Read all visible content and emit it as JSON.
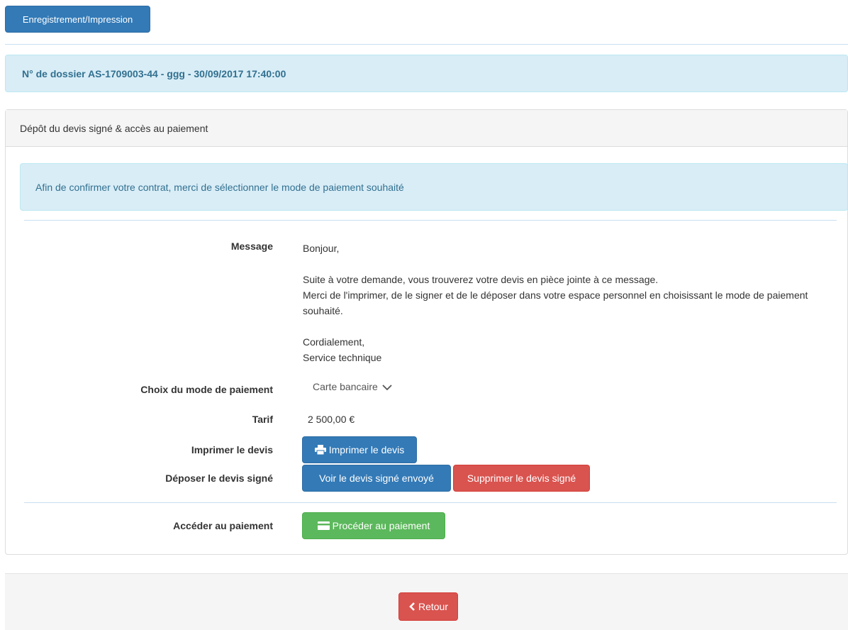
{
  "toolbar": {
    "save_print_label": "Enregistrement/Impression"
  },
  "dossier": {
    "title": "N° de dossier AS-1709003-44 - ggg - 30/09/2017 17:40:00"
  },
  "panel": {
    "heading": "Dépôt du devis signé & accès au paiement",
    "info": "Afin de confirmer votre contrat, merci de sélectionner le mode de paiement souhaité"
  },
  "form": {
    "message_label": "Message",
    "message": {
      "greeting": "Bonjour,",
      "line1": "Suite à votre demande, vous trouverez votre devis en pièce jointe à ce message.",
      "line2": "Merci de l'imprimer, de le signer et de le déposer dans votre espace personnel en choisissant le mode de paiement souhaité.",
      "closing": "Cordialement,",
      "signature": "Service technique"
    },
    "payment_label": "Choix du mode de paiement",
    "payment_selected": "Carte bancaire",
    "price_label": "Tarif",
    "price": "2 500,00 €",
    "print_label": "Imprimer le devis",
    "print_button": "Imprimer le devis",
    "upload_label": "Déposer le devis signé",
    "view_button": "Voir le devis signé envoyé",
    "delete_button": "Supprimer le devis signé",
    "pay_label": "Accéder au paiement",
    "pay_button": "Procéder au paiement"
  },
  "footer": {
    "back_label": "Retour"
  },
  "icons": {
    "print": "print-icon",
    "card": "credit-card-icon",
    "chevron": "chevron-down-icon",
    "back": "chevron-left-icon"
  },
  "colors": {
    "primary": "#337ab7",
    "danger": "#d9534f",
    "success": "#5cb85c",
    "info_bg": "#d9edf7",
    "info_text": "#31708f"
  }
}
